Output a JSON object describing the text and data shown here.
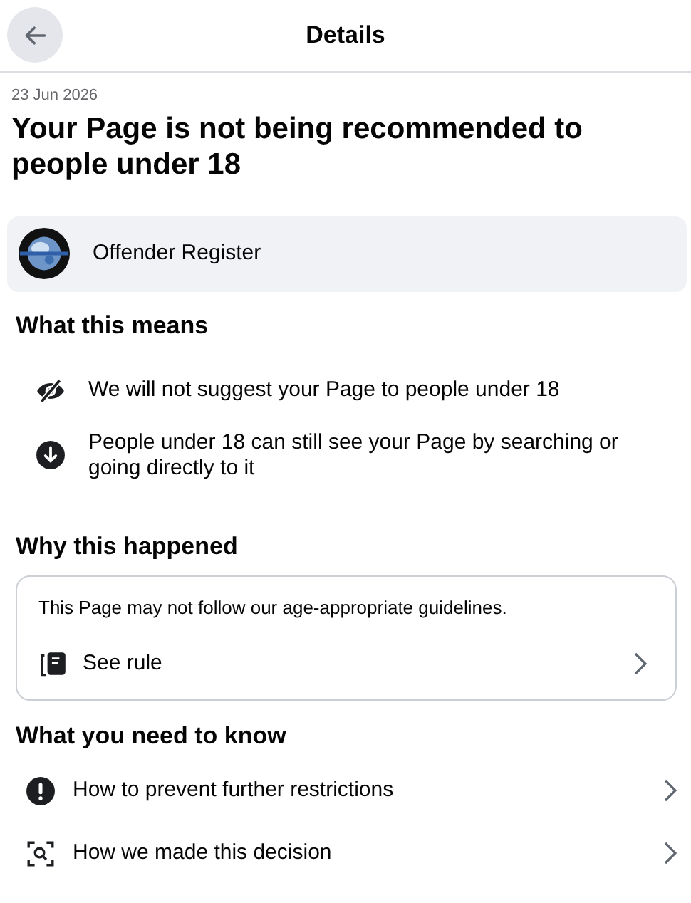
{
  "header": {
    "title": "Details"
  },
  "date": "23 Jun 2026",
  "headline": "Your Page is not being recommended to people under 18",
  "page": {
    "name": "Offender Register"
  },
  "what_this_means": {
    "heading": "What this means",
    "items": [
      {
        "text": "We will not suggest your Page to people under 18"
      },
      {
        "text": "People under 18 can still see your Page by searching or going directly to it"
      }
    ]
  },
  "why_this_happened": {
    "heading": "Why this happened",
    "text": "This Page may not follow our age-appropriate guidelines.",
    "link": "See rule"
  },
  "what_you_need_to_know": {
    "heading": "What you need to know",
    "items": [
      {
        "text": "How to prevent further restrictions"
      },
      {
        "text": "How we made this decision"
      }
    ]
  }
}
